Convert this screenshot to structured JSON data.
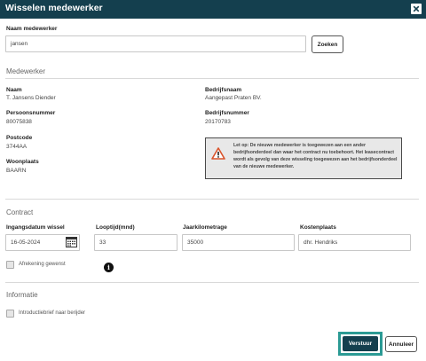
{
  "dialog": {
    "title": "Wisselen medewerker"
  },
  "search": {
    "label": "Naam medewerker",
    "value": "jansen",
    "button": "Zoeken"
  },
  "employee": {
    "section": "Medewerker",
    "name_label": "Naam",
    "name": "T. Jansens Diender",
    "personnel_label": "Persoonsnummer",
    "personnel": "80075838",
    "postcode_label": "Postcode",
    "postcode": "3744AA",
    "city_label": "Woonplaats",
    "city": "BAARN",
    "company_label": "Bedrijfsnaam",
    "company": "Aangepast Praten BV.",
    "company_no_label": "Bedrijfsnummer",
    "company_no": "20170783",
    "warning": "Let op: De nieuwe medewerker is toegewezen aan een ander bedrijfsonderdeel dan waar het contract nu toebehoort. Het leasecontract wordt als gevolg van deze wisseling toegewezen aan het bedrijfsonderdeel van de nieuwe medewerker."
  },
  "contract": {
    "section": "Contract",
    "date_label": "Ingangsdatum wissel",
    "date": "16-05-2024",
    "term_label": "Looptijd(mnd)",
    "term": "33",
    "km_label": "Jaarkilometrage",
    "km": "35000",
    "cost_label": "Kostenplaats",
    "cost": "dhr. Hendriks",
    "settlement_label": "Afrekening gewenst"
  },
  "info": {
    "section": "Informatie",
    "letter_label": "Introductiebrief naar berijder"
  },
  "actions": {
    "submit": "Verstuur",
    "cancel": "Annuleer"
  },
  "colors": {
    "header": "#143f4e",
    "accent": "#2b9a94",
    "warning_icon": "#d9532b"
  }
}
